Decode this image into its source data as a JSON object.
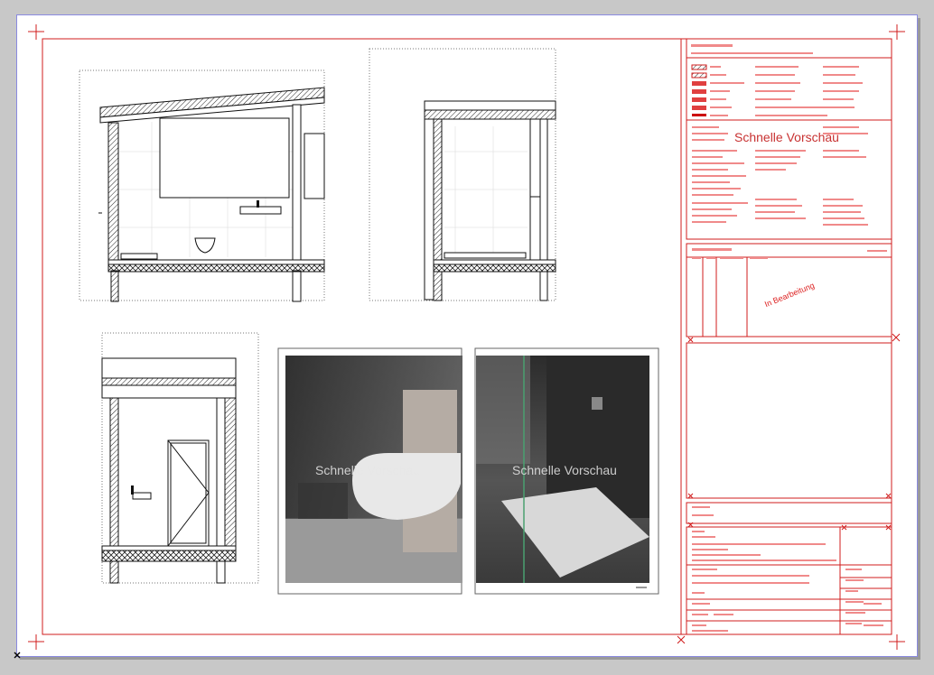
{
  "sheet": {
    "watermark_label": "Schnelle Vorschau",
    "photo_watermark_left": "Schnelle Vorschau",
    "photo_watermark_right": "Schnelle Vorschau",
    "status_stamp": "In Bearbeitung"
  },
  "colors": {
    "frame": "#d01c1c",
    "hatch": "#e86060",
    "background": "#c8c8c8",
    "paper": "#ffffff",
    "sheet_border": "#8a8ae0"
  },
  "icons": {
    "corner_mark": "crosshair-icon",
    "origin_mark": "x-marker-icon"
  }
}
